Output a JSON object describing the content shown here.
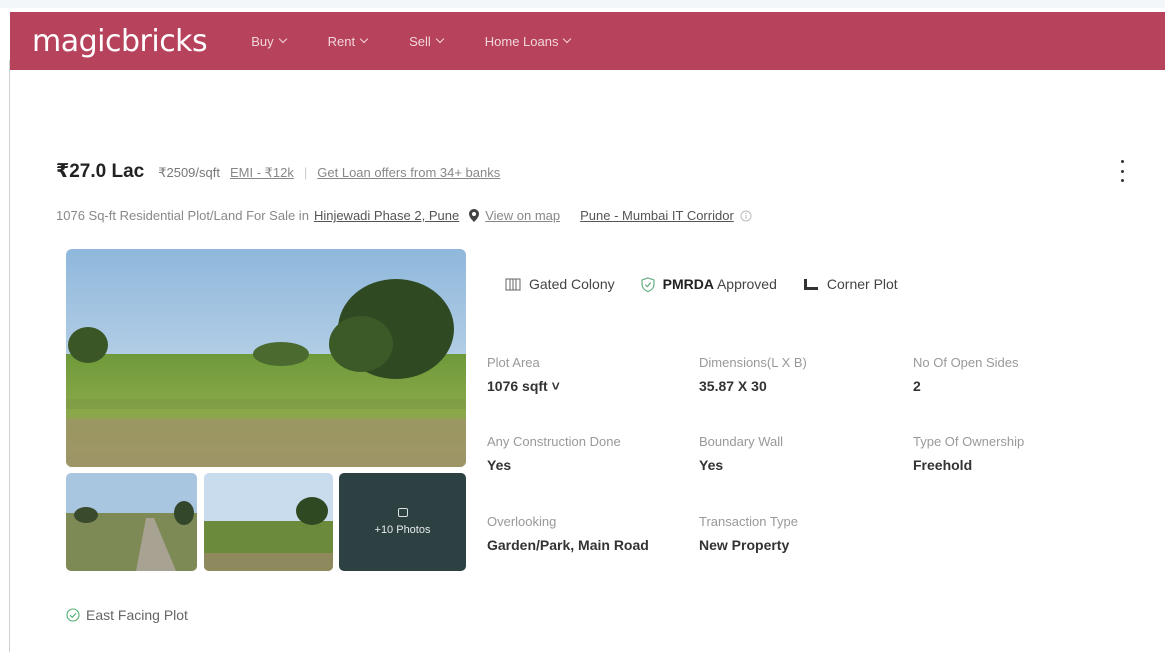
{
  "navbar": {
    "logo": "magicbricks",
    "items": [
      {
        "label": "Buy"
      },
      {
        "label": "Rent"
      },
      {
        "label": "Sell"
      },
      {
        "label": "Home Loans"
      }
    ],
    "color": "#b7425c"
  },
  "listing": {
    "price": "₹27.0 Lac",
    "price_per_sqft": "₹2509/sqft",
    "emi": "EMI - ₹12k",
    "separator": "|",
    "loan_offer": "Get Loan offers from 34+ banks",
    "subtitle_prefix": "1076 Sq-ft Residential Plot/Land For Sale in",
    "locality": "Hinjewadi Phase 2, Pune",
    "view_on_map": "View on map",
    "corridor": "Pune - Mumbai IT Corridor",
    "photos_more": "+10 Photos",
    "amenities": {
      "gated": "Gated Colony",
      "approval_bold": "PMRDA",
      "approval_rest": "Approved",
      "corner": "Corner Plot"
    },
    "details": [
      {
        "label": "Plot Area",
        "value": "1076 sqft ˅"
      },
      {
        "label": "Dimensions(L X B)",
        "value": "35.87 X 30"
      },
      {
        "label": "No Of Open Sides",
        "value": "2"
      },
      {
        "label": "Any Construction Done",
        "value": "Yes"
      },
      {
        "label": "Boundary Wall",
        "value": "Yes"
      },
      {
        "label": "Type Of Ownership",
        "value": "Freehold"
      },
      {
        "label": "Overlooking",
        "value": "Garden/Park, Main Road"
      },
      {
        "label": "Transaction Type",
        "value": "New Property"
      }
    ],
    "facing": "East Facing Plot"
  },
  "icons": {
    "gated": "gate-icon",
    "approved": "shield-check-icon",
    "corner": "corner-plot-icon",
    "pin": "map-pin-icon",
    "info": "info-icon",
    "facing": "check-circle-icon",
    "more": "kebab-menu-icon",
    "camera": "camera-icon"
  }
}
